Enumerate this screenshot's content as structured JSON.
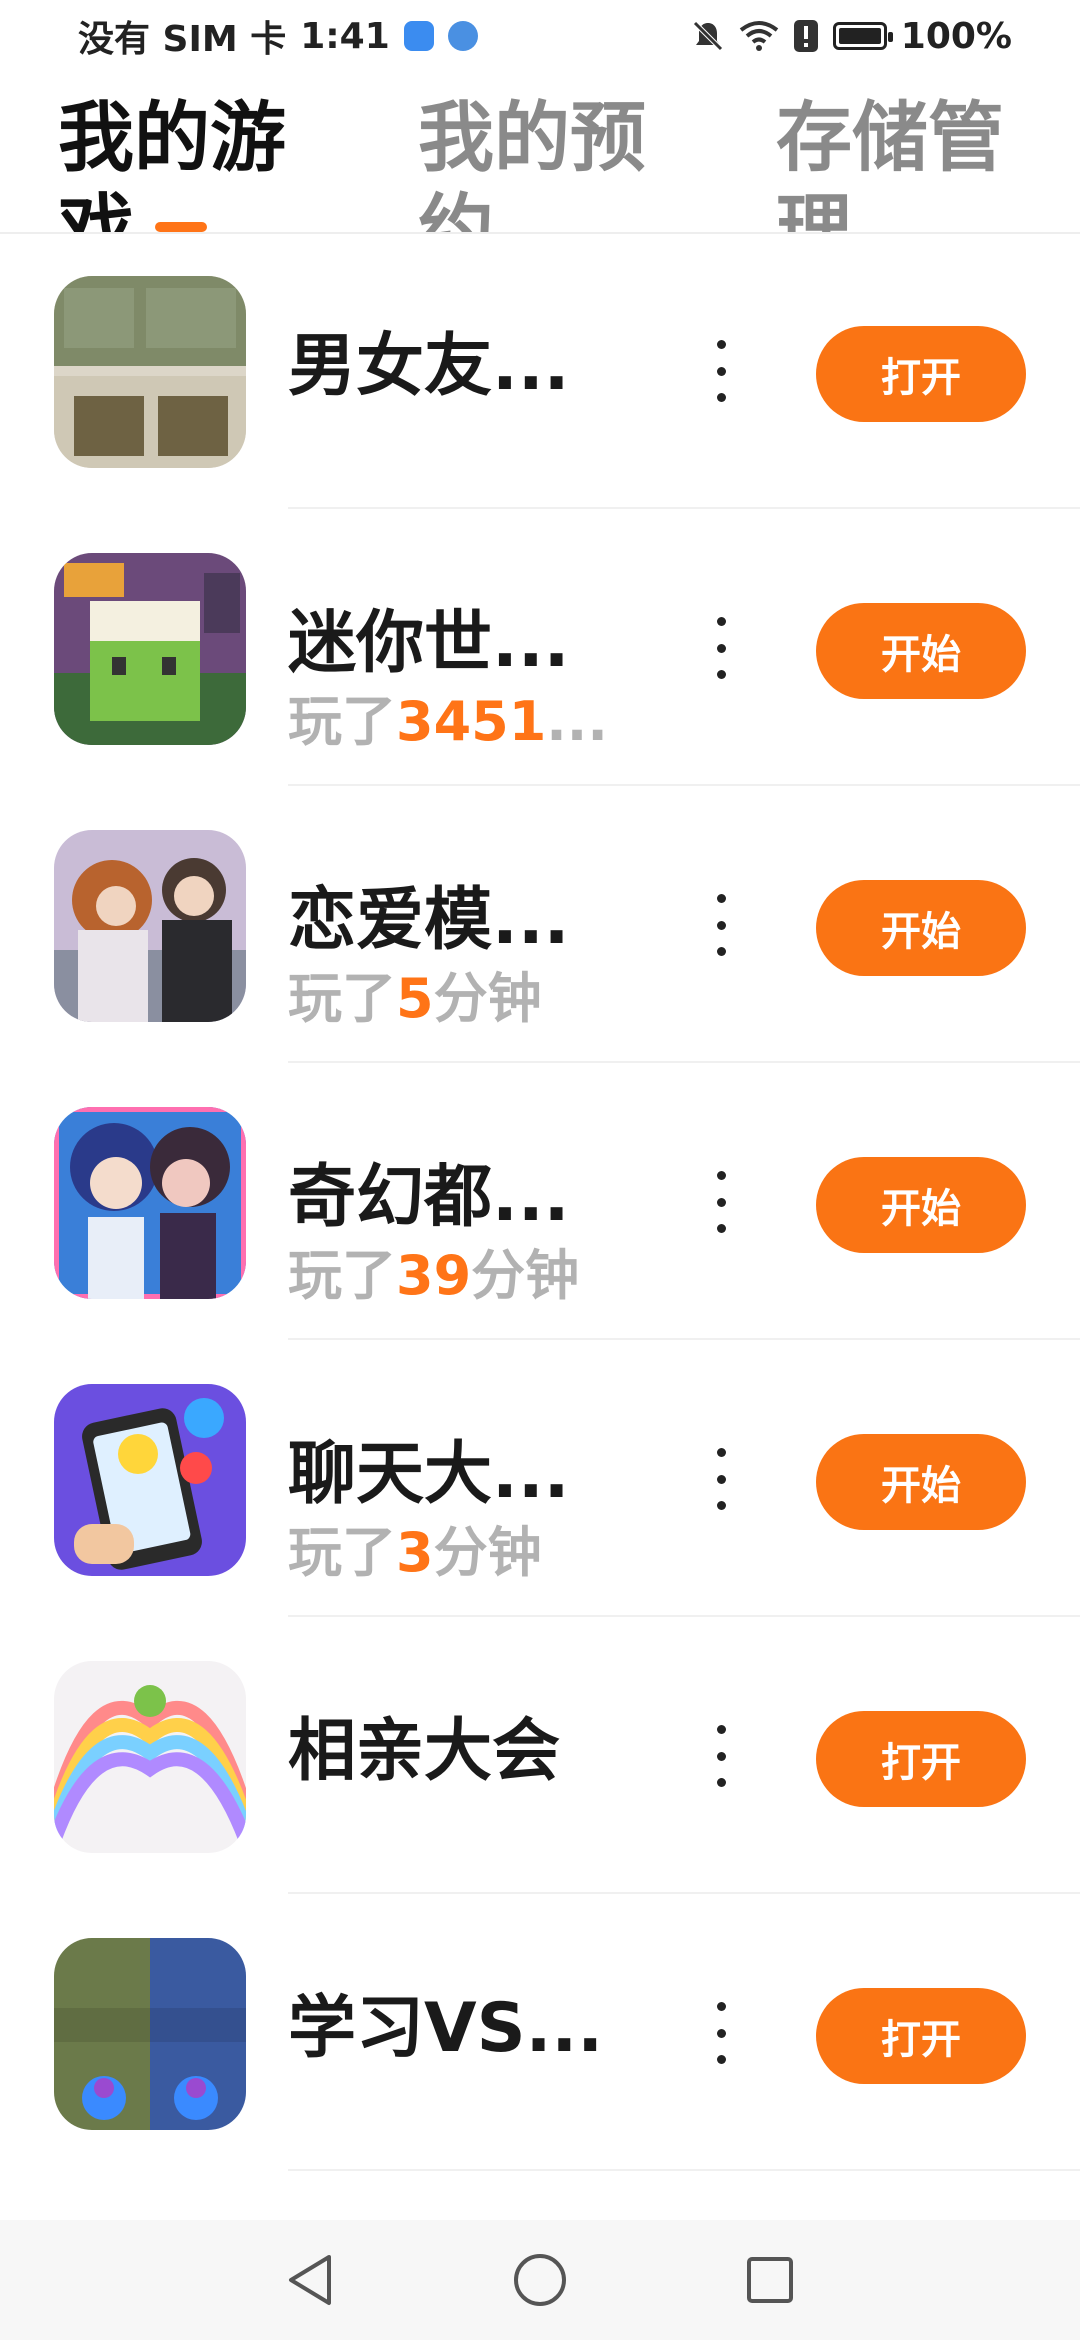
{
  "status_bar": {
    "carrier": "没有 SIM 卡",
    "time": "1:41",
    "battery": "100%",
    "icons": [
      "cloud-icon",
      "browser-icon",
      "mute-icon",
      "wifi-icon",
      "alert-icon",
      "battery-icon"
    ]
  },
  "tabs": [
    {
      "label": "我的游戏",
      "active": true
    },
    {
      "label": "我的预约",
      "active": false
    },
    {
      "label": "存储管理",
      "active": false
    }
  ],
  "accent_color": "#fa7414",
  "games": [
    {
      "title": "男女友...",
      "playtime_prefix": "",
      "playtime_value": "",
      "playtime_suffix": "",
      "button": "打开"
    },
    {
      "title": "迷你世...",
      "playtime_prefix": "玩了",
      "playtime_value": "3451",
      "playtime_suffix": "...",
      "button": "开始"
    },
    {
      "title": "恋爱模...",
      "playtime_prefix": "玩了",
      "playtime_value": "5",
      "playtime_suffix": "分钟",
      "button": "开始"
    },
    {
      "title": "奇幻都...",
      "playtime_prefix": "玩了",
      "playtime_value": "39",
      "playtime_suffix": "分钟",
      "button": "开始"
    },
    {
      "title": "聊天大...",
      "playtime_prefix": "玩了",
      "playtime_value": "3",
      "playtime_suffix": "分钟",
      "button": "开始"
    },
    {
      "title": "相亲大会",
      "playtime_prefix": "",
      "playtime_value": "",
      "playtime_suffix": "",
      "button": "打开"
    },
    {
      "title": "学习VS...",
      "playtime_prefix": "",
      "playtime_value": "",
      "playtime_suffix": "",
      "button": "打开"
    }
  ],
  "nav": {
    "back": "back-icon",
    "home": "home-icon",
    "recents": "recents-icon"
  }
}
